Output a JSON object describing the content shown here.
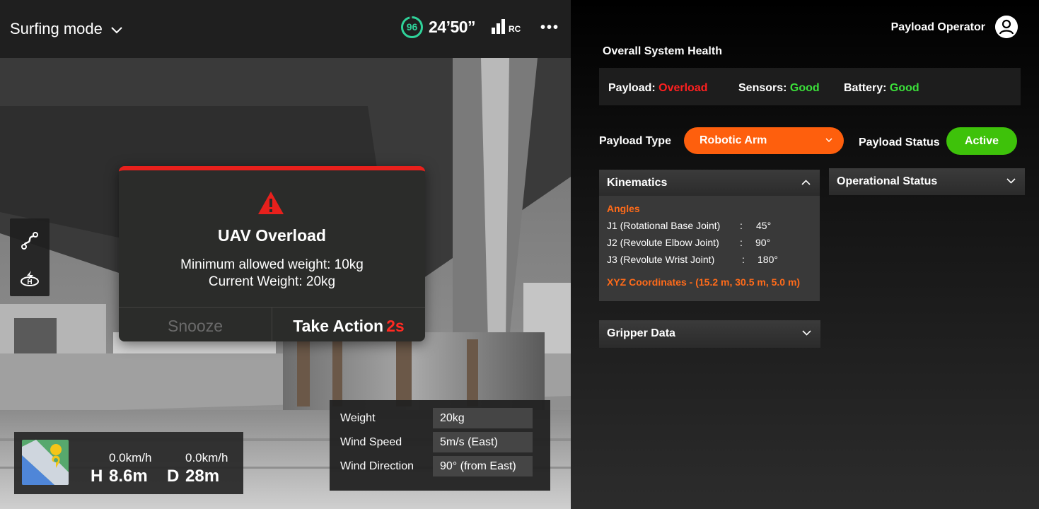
{
  "camera": {
    "mode_label": "Surfing mode",
    "battery_percent": "96",
    "flight_time": "24’50”",
    "rc_label": "RC",
    "more_label": "•••",
    "colors": {
      "battery_ring": "#2fd39a",
      "alert_red": "#e8201c"
    }
  },
  "tools": [
    {
      "name": "route-icon"
    },
    {
      "name": "home-point-icon"
    }
  ],
  "alert": {
    "title": "UAV Overload",
    "line1": "Minimum allowed weight: 10kg",
    "line2": "Current Weight: 20kg",
    "snooze_label": "Snooze",
    "take_action_label": "Take Action",
    "countdown": "2s"
  },
  "mapbox": {
    "h_speed": "0.0km/h",
    "h_label": "H",
    "h_value": "8.6m",
    "d_speed": "0.0km/h",
    "d_label": "D",
    "d_value": "28m"
  },
  "telemetry": [
    {
      "label": "Weight",
      "value": "20kg"
    },
    {
      "label": "Wind Speed",
      "value": "5m/s (East)"
    },
    {
      "label": "Wind Direction",
      "value": "90° (from East)"
    }
  ],
  "panel": {
    "operator": "Payload Operator",
    "health_title": "Overall System Health",
    "health": [
      {
        "label": "Payload:",
        "value": "Overload",
        "status": "bad"
      },
      {
        "label": "Sensors:",
        "value": "Good",
        "status": "good"
      },
      {
        "label": "Battery:",
        "value": "Good",
        "status": "good"
      }
    ],
    "payload_type_label": "Payload Type",
    "payload_type_value": "Robotic Arm",
    "payload_status_label": "Payload Status",
    "payload_status_value": "Active",
    "kinematics": {
      "title": "Kinematics",
      "angles_heading": "Angles",
      "joints": [
        {
          "name": "J1 (Rotational Base Joint)",
          "sep": ":",
          "value": "45°"
        },
        {
          "name": "J2 (Revolute Elbow Joint)",
          "sep": ":",
          "value": "90°"
        },
        {
          "name": "J3 (Revolute Wrist Joint)",
          "sep": ":",
          "value": "180°"
        }
      ],
      "xyz": "XYZ Coordinates - (15.2 m, 30.5 m, 5.0 m)"
    },
    "operational_status_title": "Operational Status",
    "gripper_title": "Gripper Data",
    "colors": {
      "accent_orange": "#fe5f0d",
      "active_green": "#3ec20a",
      "error_red": "#ff2020",
      "good_green": "#3be03a"
    }
  }
}
